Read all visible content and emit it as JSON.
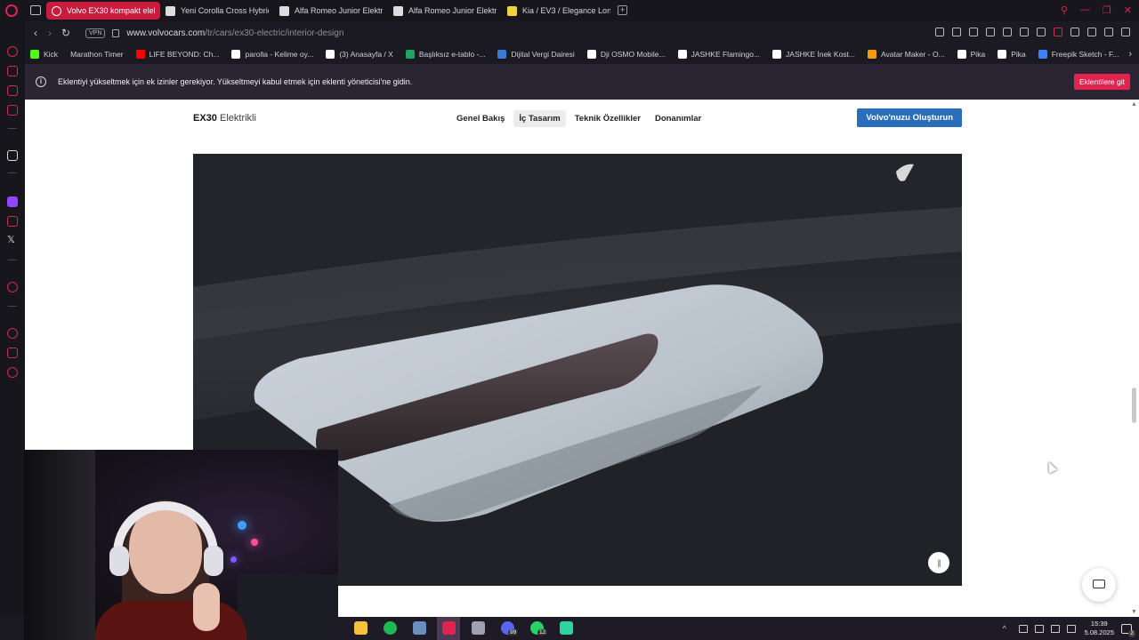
{
  "browser": {
    "tabs": [
      {
        "label": "Volvo EX30 kompakt elek",
        "active": true,
        "icon": "volvo-icon",
        "color": "#ffffff"
      },
      {
        "label": "Yeni Corolla Cross Hybrid",
        "active": false,
        "icon": "toyota-icon",
        "color": "#dddddd"
      },
      {
        "label": "Alfa Romeo Junior Elektrik",
        "active": false,
        "icon": "alfa-romeo-icon",
        "color": "#dddddd"
      },
      {
        "label": "Alfa Romeo Junior Elektrik",
        "active": false,
        "icon": "alfa-romeo-icon",
        "color": "#dddddd"
      },
      {
        "label": "Kia / EV3 / Elegance Long",
        "active": false,
        "icon": "kia-icon",
        "color": "#f4d03f"
      }
    ],
    "address": {
      "vpn_label": "VPN",
      "domain": "www.volvocars.com",
      "path": "/tr/cars/ex30-electric/interior-design"
    },
    "bookmarks": [
      {
        "label": "Kick",
        "color": "#53fc18"
      },
      {
        "label": "Marathon Timer",
        "color": ""
      },
      {
        "label": "LIFE BEYOND: Ch...",
        "color": "#ff0000"
      },
      {
        "label": "parolla - Kelime oy...",
        "color": "#ffffff"
      },
      {
        "label": "(3) Anasayfa / X",
        "color": "#ffffff"
      },
      {
        "label": "Başlıksız e-tablo -...",
        "color": "#1fa463"
      },
      {
        "label": "Dijital Vergi Dairesi",
        "color": "#3a7bd5"
      },
      {
        "label": "Dji OSMO Mobile...",
        "color": "#ffffff"
      },
      {
        "label": "JASHKE Flamingo...",
        "color": "#ffffff"
      },
      {
        "label": "JASHKE İnek Kost...",
        "color": "#ffffff"
      },
      {
        "label": "Avatar Maker - O...",
        "color": "#f39c12"
      },
      {
        "label": "Pika",
        "color": "#ffffff"
      },
      {
        "label": "Pika",
        "color": "#ffffff"
      },
      {
        "label": "Freepik Sketch - F...",
        "color": "#3b82f6"
      }
    ],
    "accent_color": "#e0244f"
  },
  "notice": {
    "message": "Eklentiyi yükseltmek için ek izinler gerekiyor. Yükseltmeyi kabul etmek için eklenti yöneticisi'ne gidin.",
    "button_label": "Eklentilere git",
    "button_color": "#e0244f"
  },
  "site": {
    "model": "EX30",
    "model_sub": "Elektrikli",
    "menu": [
      {
        "label": "Genel Bakış",
        "active": false
      },
      {
        "label": "İç Tasarım",
        "active": true
      },
      {
        "label": "Teknik Özellikler",
        "active": false
      },
      {
        "label": "Donanımlar",
        "active": false
      }
    ],
    "cta_label": "Volvo'nuzu Oluşturun",
    "cta_color": "#2a6ebb",
    "pause_icon": "pause-icon",
    "chat_icon": "chat-icon"
  },
  "taskbar": {
    "apps": [
      {
        "name": "file-explorer-icon",
        "color": "#f3c13a"
      },
      {
        "name": "spotify-icon",
        "color": "#1db954"
      },
      {
        "name": "app-icon",
        "color": "#6c8ebf"
      },
      {
        "name": "opera-gx-icon",
        "color": "#e0244f"
      },
      {
        "name": "app-icon-2",
        "color": "#a0a0b0"
      },
      {
        "name": "discord-icon",
        "color": "#5865f2",
        "badge": "99"
      },
      {
        "name": "whatsapp-icon",
        "color": "#25d366",
        "badge": "12"
      },
      {
        "name": "app-icon-3",
        "color": "#2dd4a0"
      }
    ],
    "time": "15:39",
    "date": "5.08.2025",
    "notification_count": "2"
  }
}
